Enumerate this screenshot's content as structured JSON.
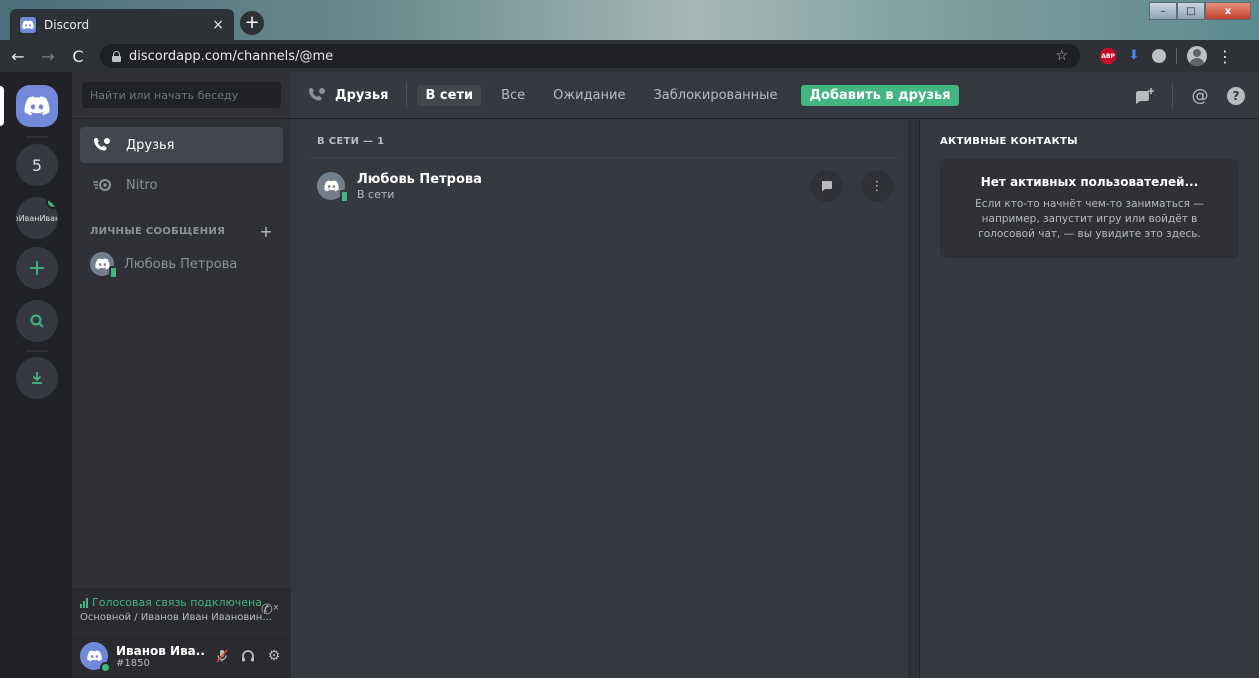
{
  "browser": {
    "tab_title": "Discord",
    "tab_close": "×",
    "new_tab": "+",
    "url": "discordapp.com/channels/@me",
    "ext_abp": "ABP",
    "win_min": "–",
    "win_max": "□",
    "win_close": "x"
  },
  "guilds": {
    "notification_count": "5",
    "server_name": "оИванИван"
  },
  "sidebar": {
    "search_placeholder": "Найти или начать беседу",
    "nav": [
      {
        "label": "Друзья"
      },
      {
        "label": "Nitro"
      }
    ],
    "dm_section": "ЛИЧНЫЕ СООБЩЕНИЯ",
    "dm_add": "+",
    "dms": [
      {
        "name": "Любовь Петрова"
      }
    ],
    "voice": {
      "status": "Голосовая связь подключена",
      "channel": "Основной / Иванов Иван Ивановин..."
    },
    "user": {
      "name": "Иванов Ива...",
      "tag": "#1850"
    }
  },
  "topbar": {
    "title": "Друзья",
    "tabs": [
      "В сети",
      "Все",
      "Ожидание",
      "Заблокированные"
    ],
    "add_friend": "Добавить в друзья",
    "at": "@",
    "help": "?"
  },
  "friends": {
    "header": "В СЕТИ — 1",
    "list": [
      {
        "name": "Любовь Петрова",
        "status": "В сети"
      }
    ]
  },
  "activity": {
    "title": "АКТИВНЫЕ КОНТАКТЫ",
    "empty_title": "Нет активных пользователей...",
    "empty_text": "Если кто-то начнёт чем-то заниматься — например, запустит игру или войдёт в голосовой чат, — вы увидите это здесь."
  },
  "colors": {
    "blurple": "#7289da",
    "green": "#43b581",
    "red": "#f04747",
    "bg_main": "#36393f",
    "bg_sidebar": "#2f3136",
    "bg_guilds": "#202225"
  }
}
